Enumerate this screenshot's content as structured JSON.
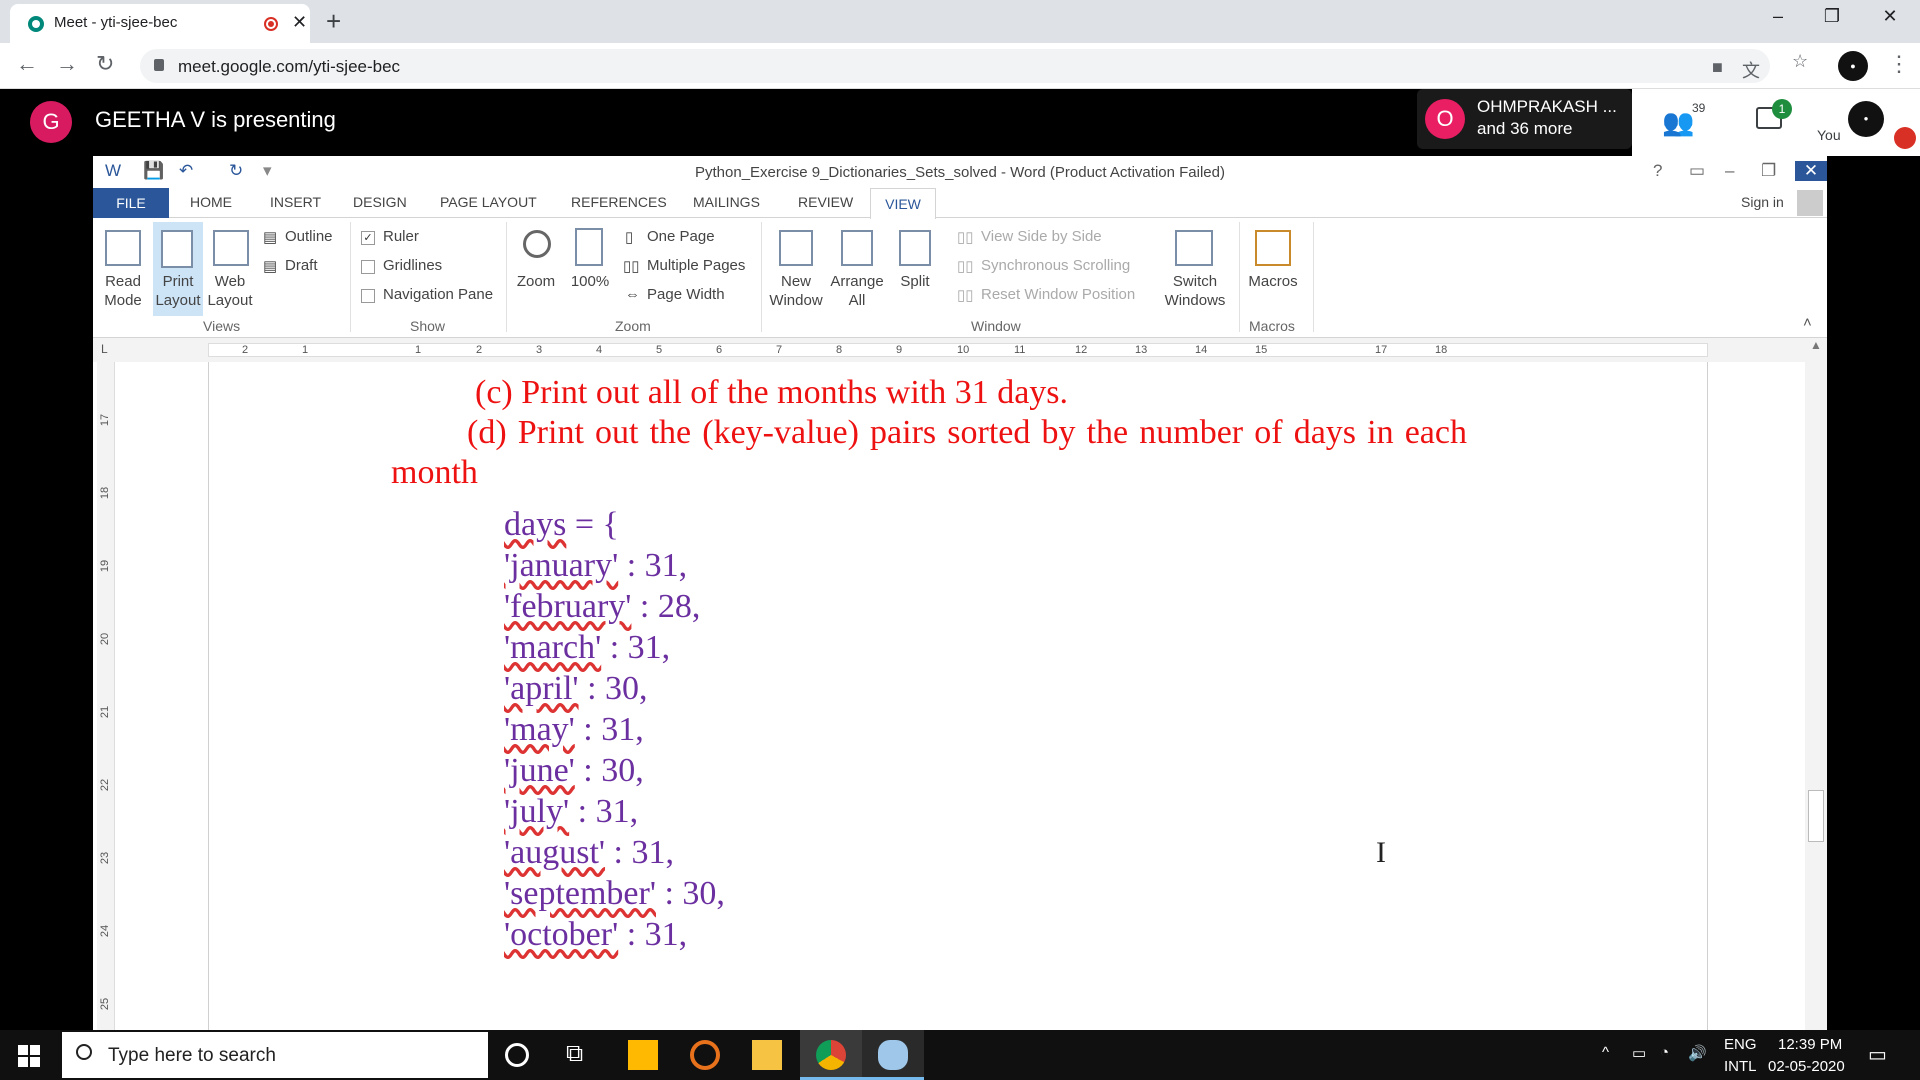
{
  "browser": {
    "tab_title": "Meet - yti-sjee-bec",
    "url": "meet.google.com/yti-sjee-bec"
  },
  "meet": {
    "presenter_initial": "G",
    "presenter_text": "GEETHA V is presenting",
    "participant_initial": "O",
    "participant_name": "OHMPRAKASH ...",
    "participant_more": "and 36 more",
    "people_count": "39",
    "chat_badge": "1",
    "you_label": "You"
  },
  "word": {
    "doc_title": "Python_Exercise 9_Dictionaries_Sets_solved - Word (Product Activation Failed)",
    "help": "?",
    "sign_in": "Sign in",
    "tabs": [
      "FILE",
      "HOME",
      "INSERT",
      "DESIGN",
      "PAGE LAYOUT",
      "REFERENCES",
      "MAILINGS",
      "REVIEW",
      "VIEW"
    ],
    "ribbon": {
      "read_mode": [
        "Read",
        "Mode"
      ],
      "print_layout": [
        "Print",
        "Layout"
      ],
      "web_layout": [
        "Web",
        "Layout"
      ],
      "outline": "Outline",
      "draft": "Draft",
      "views_group": "Views",
      "ruler": "Ruler",
      "gridlines": "Gridlines",
      "navigation_pane": "Navigation Pane",
      "show_group": "Show",
      "zoom": "Zoom",
      "zoom_100": "100%",
      "one_page": "One Page",
      "multiple_pages": "Multiple Pages",
      "page_width": "Page Width",
      "zoom_group": "Zoom",
      "new_window": [
        "New",
        "Window"
      ],
      "arrange_all": [
        "Arrange",
        "All"
      ],
      "split": "Split",
      "view_side_by_side": "View Side by Side",
      "synchronous_scrolling": "Synchronous Scrolling",
      "reset_window_position": "Reset Window Position",
      "switch_windows": [
        "Switch",
        "Windows"
      ],
      "window_group": "Window",
      "macros": "Macros",
      "macros_group": "Macros"
    },
    "ruler_ticks": [
      "2",
      "1",
      "1",
      "2",
      "3",
      "4",
      "5",
      "6",
      "7",
      "8",
      "9",
      "10",
      "11",
      "12",
      "13",
      "14",
      "15",
      "17",
      "18"
    ],
    "vruler_ticks": [
      "17",
      "18",
      "19",
      "20",
      "21",
      "22",
      "23",
      "24",
      "25"
    ],
    "document": {
      "line_c": "(c) Print out all of the months with 31 days.",
      "line_d": "(d) Print out the (key-value) pairs sorted by the number of days in each",
      "line_d2": "month",
      "code": [
        {
          "key": "days",
          "rest": " = {"
        },
        {
          "key": "'january'",
          "rest": " : 31,"
        },
        {
          "key": "'february'",
          "rest": " : 28,"
        },
        {
          "key": "'march'",
          "rest": " : 31,"
        },
        {
          "key": "'april'",
          "rest": " : 30,"
        },
        {
          "key": "'may'",
          "rest": " : 31,"
        },
        {
          "key": "'june'",
          "rest": " : 30,"
        },
        {
          "key": "'july'",
          "rest": " : 31,"
        },
        {
          "key": "'august'",
          "rest": " : 31,"
        },
        {
          "key": "'september'",
          "rest": " : 30,"
        },
        {
          "key": "'october'",
          "rest": " : 31,"
        }
      ]
    }
  },
  "taskbar": {
    "search_placeholder": "Type here to search",
    "lang1": "ENG",
    "lang2": "INTL",
    "time": "12:39 PM",
    "date": "02-05-2020"
  }
}
